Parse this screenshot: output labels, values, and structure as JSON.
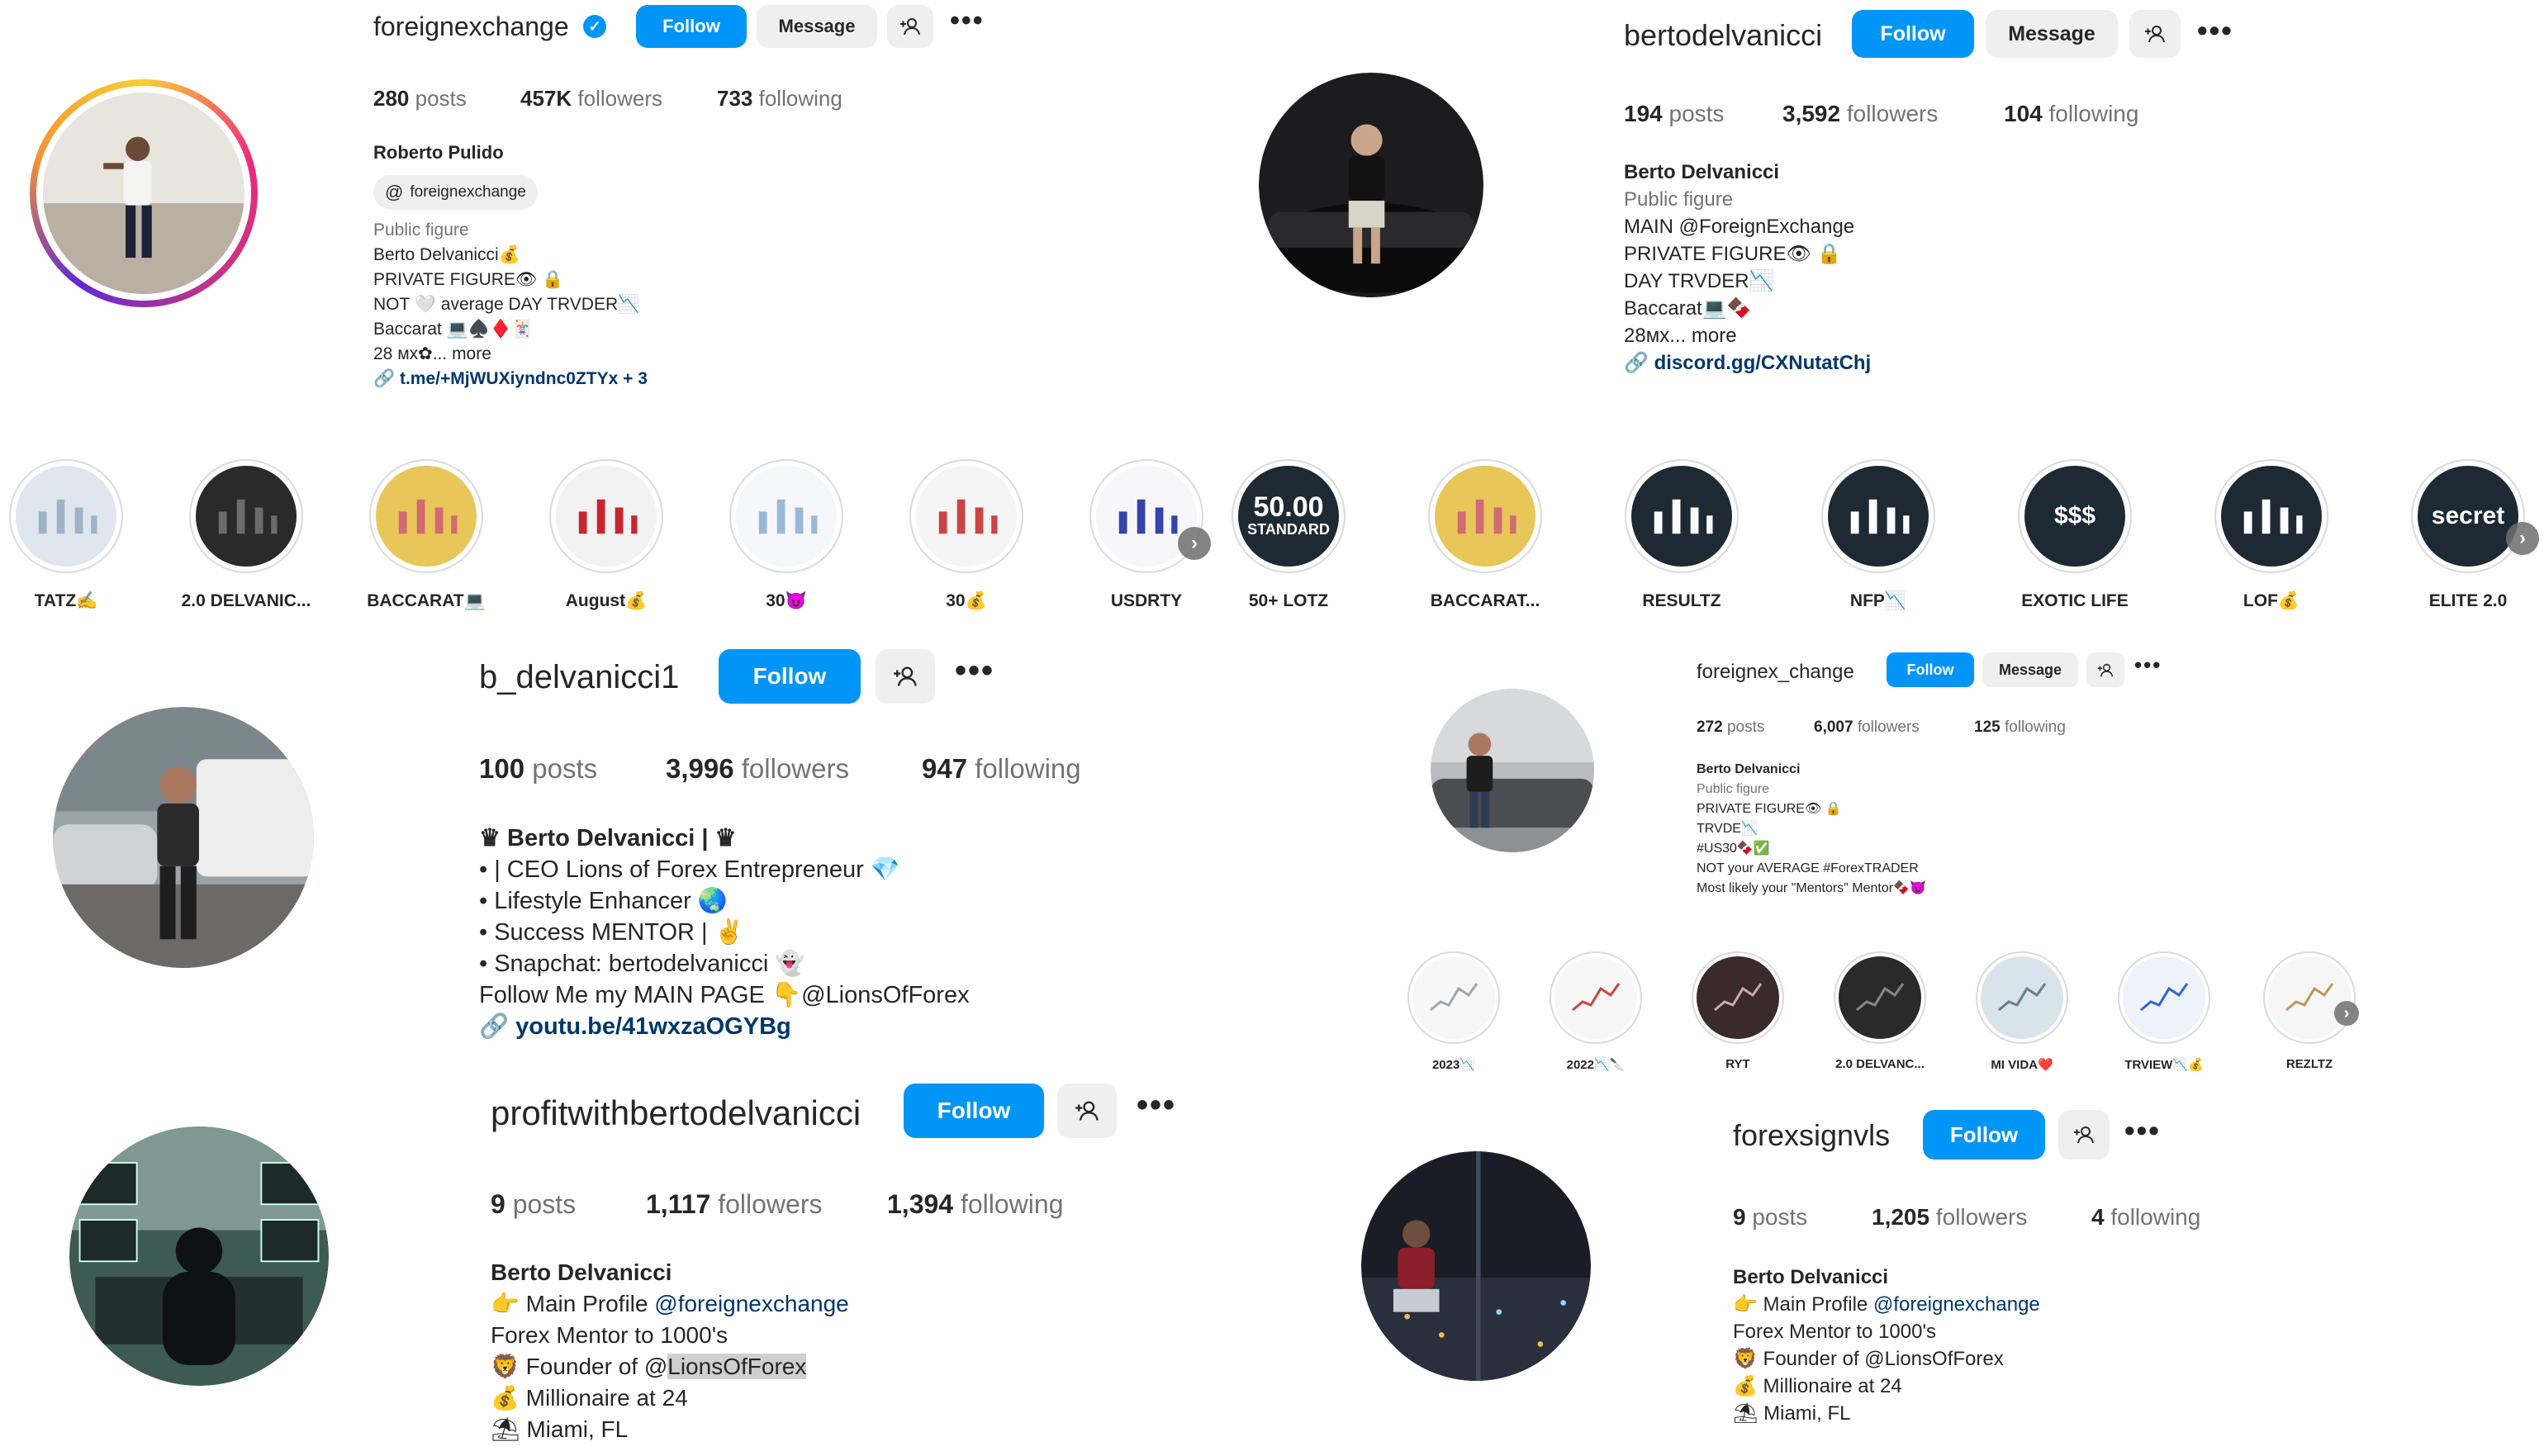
{
  "icons": [
    "verified-badge-icon",
    "add-person-icon",
    "more-options-icon",
    "threads-icon",
    "link-icon",
    "chevron-right-icon"
  ],
  "colors": {
    "follow_button": "#0095f6",
    "secondary_button": "#efefef",
    "link": "#00376b",
    "muted_text": "#737373",
    "text": "#262626"
  },
  "p1": {
    "username": "foreignexchange",
    "follow": "Follow",
    "message": "Message",
    "posts": {
      "n": "280",
      "l": "posts"
    },
    "followers": {
      "n": "457K",
      "l": "followers"
    },
    "following": {
      "n": "733",
      "l": "following"
    },
    "name": "Roberto Pulido",
    "threads": "foreignexchange",
    "bio": [
      "Public figure",
      "Berto Delvanicci💰",
      "PRIVATE FIGURE👁 🔒",
      "NOT 🤍 average DAY TRVDER📉",
      "Baccarat 💻♠️♦️🃏",
      "28 мх✿... more"
    ],
    "link": "t.me/+MjWUXiyndnc0ZTYx + 3"
  },
  "p2": {
    "username": "bertodelvanicci",
    "follow": "Follow",
    "message": "Message",
    "posts": {
      "n": "194",
      "l": "posts"
    },
    "followers": {
      "n": "3,592",
      "l": "followers"
    },
    "following": {
      "n": "104",
      "l": "following"
    },
    "name": "Berto Delvanicci",
    "bio": [
      "Public figure",
      "MAIN @ForeignExchange",
      "PRIVATE FIGURE👁 🔒",
      "DAY TRVDER📉",
      "Baccarat💻🍫",
      "28мх... more"
    ],
    "link": "discord.gg/CXNutatChj"
  },
  "highlights_row": [
    {
      "label": "TATZ✍️"
    },
    {
      "label": "2.0 DELVANIC..."
    },
    {
      "label": "BACCARAT💻"
    },
    {
      "label": "August💰"
    },
    {
      "label": "30😈"
    },
    {
      "label": "30💰"
    },
    {
      "label": "USDRTY"
    },
    {
      "label": "50+ LOTZ",
      "badge_1": "50.00",
      "badge_2": "STANDARD"
    },
    {
      "label": "BACCARAT..."
    },
    {
      "label": "RESULTZ"
    },
    {
      "label": "NFP📉"
    },
    {
      "label": "EXOTIC LIFE",
      "badge_1": "$$$"
    },
    {
      "label": "LOF💰"
    },
    {
      "label": "ELITE 2.0",
      "badge_1": "secret"
    }
  ],
  "p3": {
    "username": "b_delvanicci1",
    "follow": "Follow",
    "posts": {
      "n": "100",
      "l": "posts"
    },
    "followers": {
      "n": "3,996",
      "l": "followers"
    },
    "following": {
      "n": "947",
      "l": "following"
    },
    "name": "♛ Berto Delvanicci | ♛",
    "bio": [
      "• | CEO Lions of Forex Entrepreneur 💎",
      "• Lifestyle Enhancer 🌏",
      "• Success MENTOR | ✌️",
      "• Snapchat: bertodelvanicci 👻",
      "Follow Me my MAIN PAGE 👇@LionsOfForex"
    ],
    "link": "youtu.be/41wxzaOGYBg"
  },
  "p4": {
    "username": "foreignex_change",
    "follow": "Follow",
    "message": "Message",
    "posts": {
      "n": "272",
      "l": "posts"
    },
    "followers": {
      "n": "6,007",
      "l": "followers"
    },
    "following": {
      "n": "125",
      "l": "following"
    },
    "name": "Berto Delvanicci",
    "bio": [
      "Public figure",
      "PRIVATE FIGURE👁 🔒",
      "TRVDE📉",
      "#US30🍫✅",
      "NOT your AVERAGE #ForexTRADER",
      "Most likely your \"Mentors\" Mentor🍫😈"
    ],
    "highlights": [
      {
        "label": "2023📉"
      },
      {
        "label": "2022📉🔪"
      },
      {
        "label": "RYT"
      },
      {
        "label": "2.0 DELVANC..."
      },
      {
        "label": "MI VIDA❤️"
      },
      {
        "label": "TRVIEW📉💰"
      },
      {
        "label": "REZLTZ"
      }
    ]
  },
  "p5": {
    "username": "profitwithbertodelvanicci",
    "follow": "Follow",
    "posts": {
      "n": "9",
      "l": "posts"
    },
    "followers": {
      "n": "1,117",
      "l": "followers"
    },
    "following": {
      "n": "1,394",
      "l": "following"
    },
    "name": "Berto Delvanicci",
    "bio_1_pre": "👉 Main Profile ",
    "bio_1_mention": "@foreignexchange",
    "bio_2": "Forex Mentor to 1000's",
    "bio_3_pre": "🦁 Founder of @",
    "bio_3_sel": "LionsOfForex",
    "bio_4": "💰 Millionaire at 24",
    "bio_5": "⛱ Miami, FL"
  },
  "p6": {
    "username": "forexsignvls",
    "follow": "Follow",
    "posts": {
      "n": "9",
      "l": "posts"
    },
    "followers": {
      "n": "1,205",
      "l": "followers"
    },
    "following": {
      "n": "4",
      "l": "following"
    },
    "name": "Berto Delvanicci",
    "bio_1_pre": "👉 Main Profile ",
    "bio_1_mention": "@foreignexchange",
    "bio_2": "Forex Mentor to 1000's",
    "bio_3": "🦁 Founder of @LionsOfForex",
    "bio_4": "💰 Millionaire at 24",
    "bio_5": "⛱ Miami, FL"
  }
}
